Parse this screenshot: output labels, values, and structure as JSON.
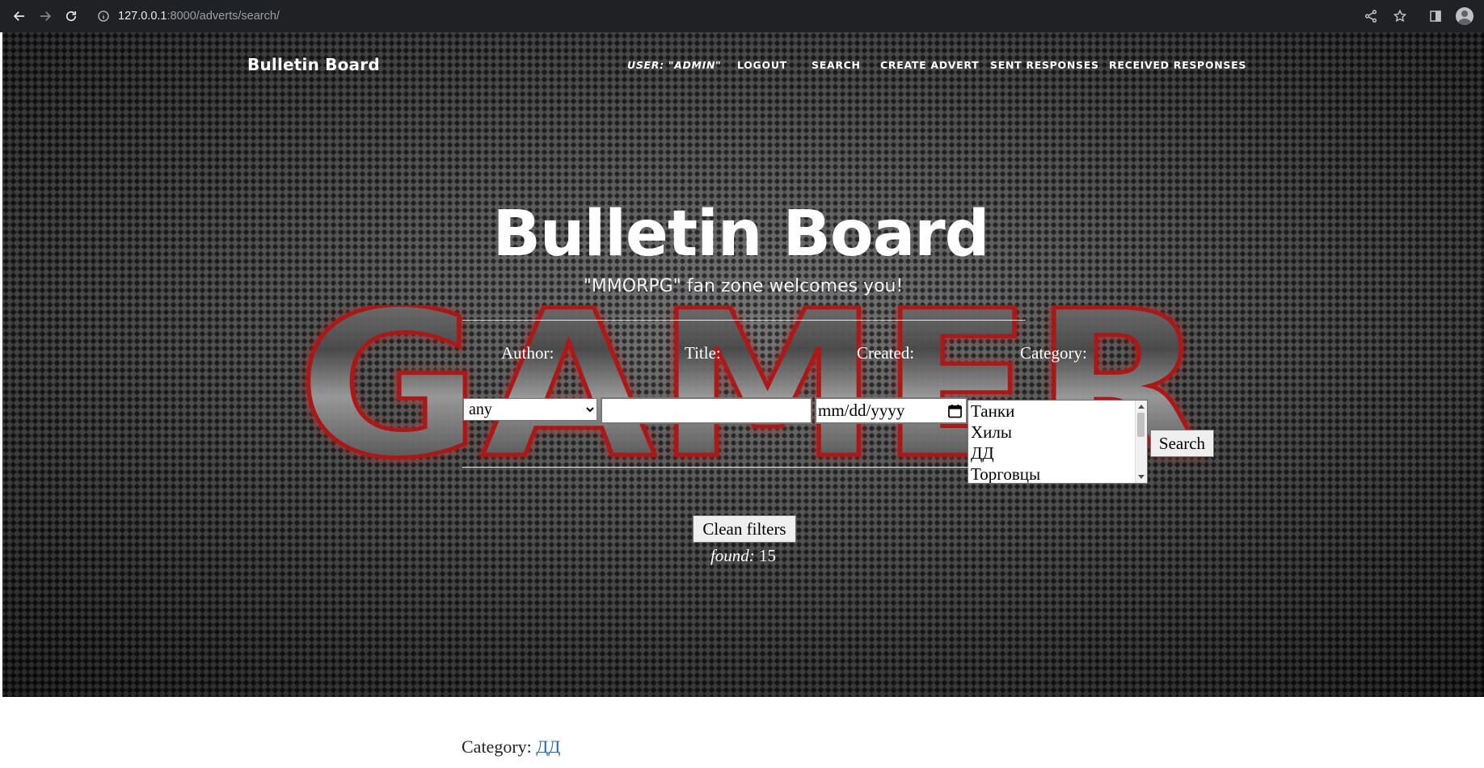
{
  "browser": {
    "url_host": "127.0.0.1",
    "url_rest": ":8000/adverts/search/"
  },
  "header": {
    "brand": "Bulletin Board",
    "nav": {
      "user": "USER: \"ADMIN\"",
      "logout": "LOGOUT",
      "search": "SEARCH",
      "create": "CREATE ADVERT",
      "sent": "SENT RESPONSES",
      "received": "RECEIVED RESPONSES"
    }
  },
  "hero": {
    "title": "Bulletin Board",
    "subtitle": "\"MMORPG\" fan zone welcomes you!",
    "background_logo": "GAMER"
  },
  "filters": {
    "author_label": "Author:",
    "title_label": "Title:",
    "created_label": "Created:",
    "category_label": "Category:",
    "author_selected": "any",
    "title_value": "",
    "created_placeholder": "mm/dd/yyyy",
    "category_options": [
      "Танки",
      "Хилы",
      "ДД",
      "Торговцы"
    ],
    "search_button": "Search",
    "clean_button": "Clean filters",
    "found_label": "found:",
    "found_count": "15"
  },
  "results": {
    "first_category_label": "Category:",
    "first_category_value": "ДД"
  },
  "colors": {
    "chrome_bg": "#202124",
    "link": "#2c6ba0",
    "hero_text": "#ffffff"
  },
  "icons": [
    "back-icon",
    "forward-icon",
    "reload-icon",
    "info-icon",
    "share-icon",
    "star-icon",
    "side-panel-icon",
    "profile-icon",
    "calendar-icon"
  ]
}
